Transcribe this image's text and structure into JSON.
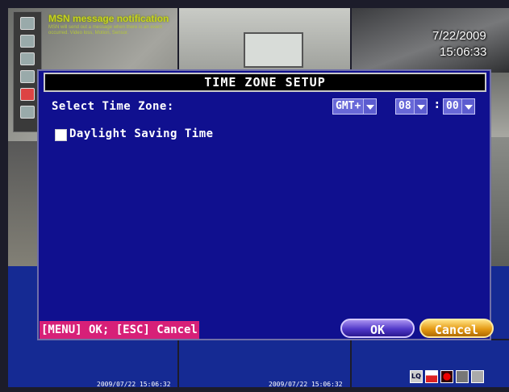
{
  "monitor": {
    "msn_title": "MSN message notification",
    "msn_body": "MSN will send out a message when there is an event occurred. Video loss, Motion, Sensor.",
    "date": "7/22/2009",
    "time": "15:06:33"
  },
  "dialog": {
    "title": "TIME ZONE SETUP",
    "select_label": "Select Time Zone:",
    "gmt_value": "GMT+",
    "hour_value": "08",
    "colon": ":",
    "minute_value": "00",
    "dst_label": "Daylight Saving Time",
    "hint": "[MENU] OK; [ESC] Cancel",
    "ok_label": "OK",
    "cancel_label": "Cancel"
  },
  "status": {
    "timestamp_1": "2009/07/22 15:06:32",
    "timestamp_2": "2009/07/22 15:06:32",
    "lq_label": "LQ"
  },
  "colors": {
    "dialog_bg": "#10108f",
    "hint_bg": "#d72078",
    "ok_btn": "#5038c8",
    "cancel_btn": "#e49a14"
  }
}
